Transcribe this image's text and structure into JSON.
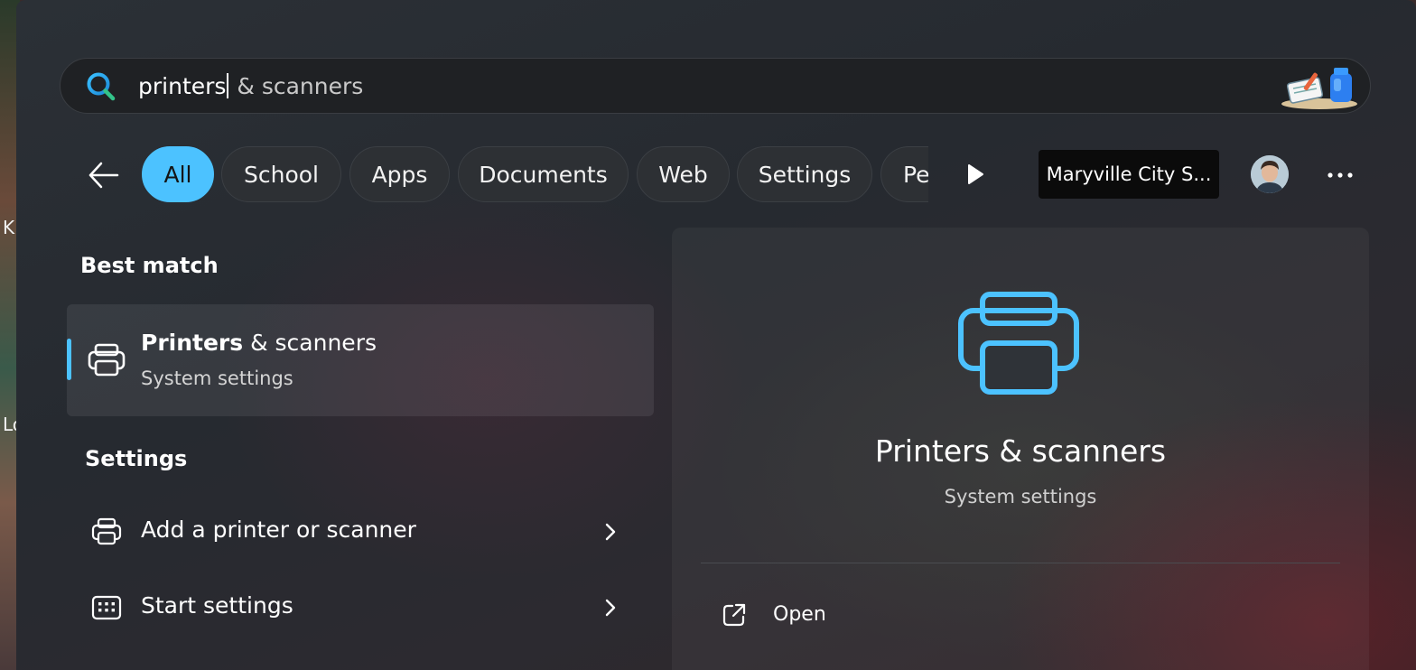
{
  "desktop": {
    "fragments": [
      "K",
      "Lo"
    ]
  },
  "search": {
    "typed": "printers",
    "suggestion": " & scanners"
  },
  "filters": [
    {
      "label": "All",
      "active": true
    },
    {
      "label": "School",
      "active": false
    },
    {
      "label": "Apps",
      "active": false
    },
    {
      "label": "Documents",
      "active": false
    },
    {
      "label": "Web",
      "active": false
    },
    {
      "label": "Settings",
      "active": false
    },
    {
      "label": "Pe",
      "active": false
    }
  ],
  "organization": "Maryville City S...",
  "best_match": {
    "heading": "Best match",
    "title_bold": "Printers",
    "title_rest": " & scanners",
    "subtitle": "System settings"
  },
  "settings_section": {
    "heading": "Settings",
    "items": [
      {
        "label": "Add a printer or scanner",
        "icon": "printer-icon"
      },
      {
        "label": "Start settings",
        "icon": "start-settings-icon"
      }
    ]
  },
  "preview": {
    "title": "Printers & scanners",
    "subtitle": "System settings",
    "actions": [
      {
        "label": "Open",
        "icon": "open-external-icon"
      }
    ]
  },
  "colors": {
    "accent": "#4cc2ff",
    "panel_bg": "#262a30",
    "text": "#ffffff",
    "subtext": "#d4d4d4"
  }
}
